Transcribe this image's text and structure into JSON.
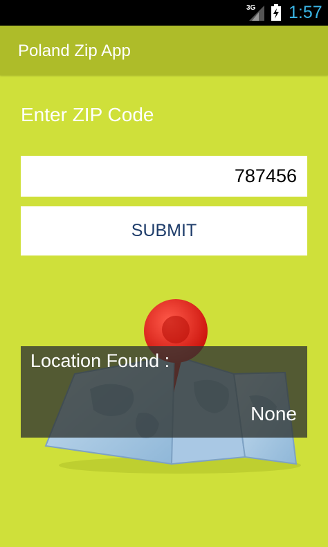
{
  "status_bar": {
    "network": "3G",
    "time": "1:57",
    "icons": [
      "signal-icon",
      "battery-charging-icon"
    ]
  },
  "app_bar": {
    "title": "Poland Zip App"
  },
  "form": {
    "prompt_label": "Enter ZIP  Code",
    "zip_value": "787456",
    "submit_label": "SUBMIT"
  },
  "result": {
    "label": "Location Found :",
    "value": "None"
  },
  "colors": {
    "background": "#cfe03a",
    "app_bar": "#aebc29",
    "clock": "#3ab5e6",
    "button_text": "#1f3d6b",
    "pin": "#e21b12"
  }
}
